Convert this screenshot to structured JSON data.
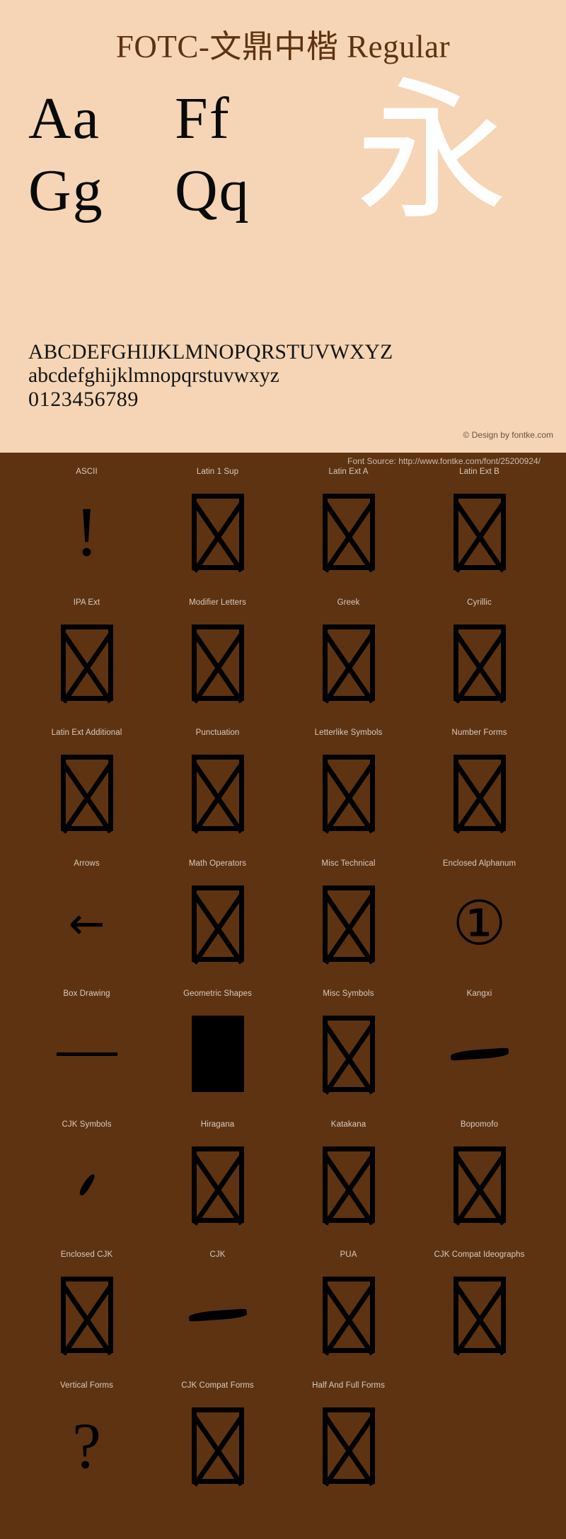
{
  "colors": {
    "specimen_bg": "#F5D5B5",
    "coverage_bg": "#5E3311",
    "title_text": "#5E3311",
    "glyph_black": "#0A0A0A",
    "watermark_white": "#FFFFFF",
    "coverage_label": "#D9CBC0"
  },
  "specimen": {
    "title": "FOTC-文鼎中楷 Regular",
    "watermark_glyph": "永",
    "samples": [
      [
        "Aa",
        "Ff"
      ],
      [
        "Gg",
        "Qq"
      ]
    ],
    "uppercase": "ABCDEFGHIJKLMNOPQRSTUVWXYZ",
    "lowercase": "abcdefghijklmnopqrstuvwxyz",
    "digits": "0123456789",
    "credit": "© Design by fontke.com"
  },
  "coverage": {
    "source": "Font Source: http://www.fontke.com/font/25200924/",
    "rows": [
      [
        {
          "label": "ASCII",
          "glyph": "!",
          "kind": "bang"
        },
        {
          "label": "Latin 1 Sup",
          "glyph": "",
          "kind": "notdef"
        },
        {
          "label": "Latin Ext A",
          "glyph": "",
          "kind": "notdef"
        },
        {
          "label": "Latin Ext B",
          "glyph": "",
          "kind": "notdef"
        }
      ],
      [
        {
          "label": "IPA Ext",
          "glyph": "",
          "kind": "notdef"
        },
        {
          "label": "Modifier Letters",
          "glyph": "",
          "kind": "notdef"
        },
        {
          "label": "Greek",
          "glyph": "",
          "kind": "notdef"
        },
        {
          "label": "Cyrillic",
          "glyph": "",
          "kind": "notdef"
        }
      ],
      [
        {
          "label": "Latin Ext Additional",
          "glyph": "",
          "kind": "notdef"
        },
        {
          "label": "Punctuation",
          "glyph": "",
          "kind": "notdef"
        },
        {
          "label": "Letterlike Symbols",
          "glyph": "",
          "kind": "notdef"
        },
        {
          "label": "Number Forms",
          "glyph": "",
          "kind": "notdef"
        }
      ],
      [
        {
          "label": "Arrows",
          "glyph": "←",
          "kind": "arrow"
        },
        {
          "label": "Math Operators",
          "glyph": "",
          "kind": "notdef"
        },
        {
          "label": "Misc Technical",
          "glyph": "",
          "kind": "notdef"
        },
        {
          "label": "Enclosed Alphanum",
          "glyph": "①",
          "kind": "circled"
        }
      ],
      [
        {
          "label": "Box Drawing",
          "glyph": "─",
          "kind": "hrule"
        },
        {
          "label": "Geometric Shapes",
          "glyph": "■",
          "kind": "solid"
        },
        {
          "label": "Misc Symbols",
          "glyph": "",
          "kind": "notdef"
        },
        {
          "label": "Kangxi",
          "glyph": "⼀",
          "kind": "heng"
        }
      ],
      [
        {
          "label": "CJK Symbols",
          "glyph": "、",
          "kind": "dian"
        },
        {
          "label": "Hiragana",
          "glyph": "",
          "kind": "notdef"
        },
        {
          "label": "Katakana",
          "glyph": "",
          "kind": "notdef"
        },
        {
          "label": "Bopomofo",
          "glyph": "",
          "kind": "notdef"
        }
      ],
      [
        {
          "label": "Enclosed CJK",
          "glyph": "",
          "kind": "notdef"
        },
        {
          "label": "CJK",
          "glyph": "一",
          "kind": "heng"
        },
        {
          "label": "PUA",
          "glyph": "",
          "kind": "notdef"
        },
        {
          "label": "CJK Compat Ideographs",
          "glyph": "",
          "kind": "notdef"
        }
      ],
      [
        {
          "label": "Vertical Forms",
          "glyph": "?",
          "kind": "question"
        },
        {
          "label": "CJK Compat Forms",
          "glyph": "",
          "kind": "notdef"
        },
        {
          "label": "Half And Full Forms",
          "glyph": "",
          "kind": "notdef"
        }
      ]
    ]
  }
}
